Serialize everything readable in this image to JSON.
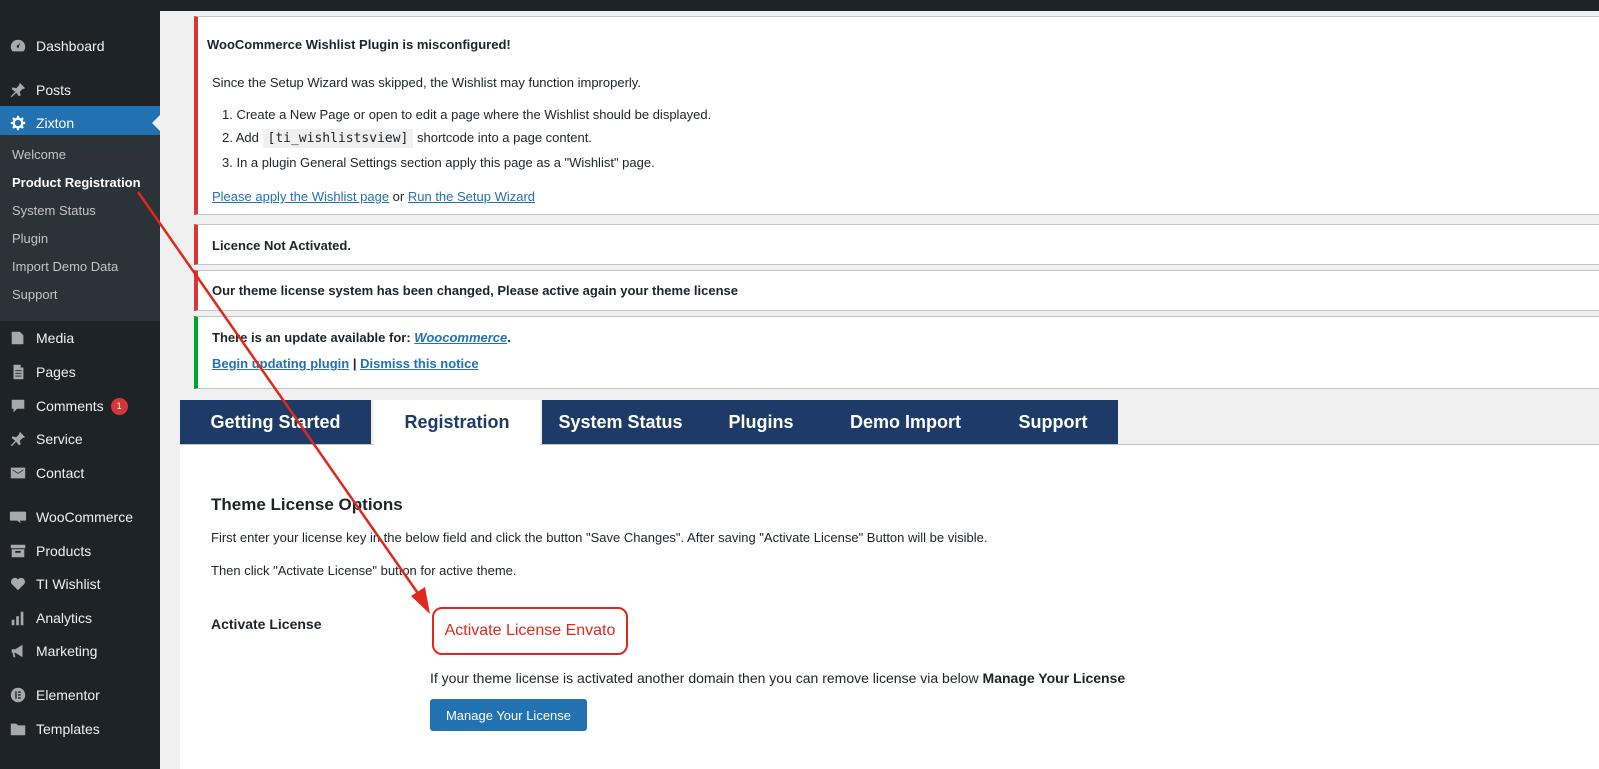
{
  "sidebar": {
    "items": [
      {
        "label": "Dashboard",
        "icon": "dashboard-icon"
      },
      {
        "label": "Posts",
        "icon": "pin-icon"
      },
      {
        "label": "Zixton",
        "icon": "gear-icon"
      },
      {
        "label": "Media",
        "icon": "media-icon"
      },
      {
        "label": "Pages",
        "icon": "pages-icon"
      },
      {
        "label": "Comments",
        "icon": "comment-icon",
        "badge": "1"
      },
      {
        "label": "Service",
        "icon": "pin-icon"
      },
      {
        "label": "Contact",
        "icon": "mail-icon"
      },
      {
        "label": "WooCommerce",
        "icon": "woo-icon"
      },
      {
        "label": "Products",
        "icon": "archive-icon"
      },
      {
        "label": "TI Wishlist",
        "icon": "heart-icon"
      },
      {
        "label": "Analytics",
        "icon": "chart-icon"
      },
      {
        "label": "Marketing",
        "icon": "megaphone-icon"
      },
      {
        "label": "Elementor",
        "icon": "elementor-icon"
      },
      {
        "label": "Templates",
        "icon": "folder-icon"
      }
    ],
    "submenu": [
      "Welcome",
      "Product Registration",
      "System Status",
      "Plugin",
      "Import Demo Data",
      "Support"
    ]
  },
  "notices": {
    "wishlist": {
      "title": "WooCommerce Wishlist Plugin is misconfigured!",
      "intro": "Since the Setup Wizard was skipped, the Wishlist may function improperly.",
      "step1": "1. Create a New Page or open to edit a page where the Wishlist should be displayed.",
      "step2_prefix": "2. Add",
      "step2_code": "[ti_wishlistsview]",
      "step2_suffix": "shortcode into a page content.",
      "step3": "3. In a plugin General Settings section apply this page as a \"Wishlist\" page.",
      "link1": "Please apply the Wishlist page",
      "or": "or",
      "link2": "Run the Setup Wizard"
    },
    "licence": "Licence Not Activated.",
    "theme_license": "Our theme license system has been changed, Please active again your theme license",
    "update": {
      "prefix": "There is an update available for:",
      "plugin": "Woocommerce",
      "link1": "Begin updating plugin",
      "sep": "|",
      "link2": "Dismiss this notice"
    }
  },
  "tabs": [
    "Getting Started",
    "Registration",
    "System Status",
    "Plugins",
    "Demo Import",
    "Support"
  ],
  "panel": {
    "title": "Theme License Options",
    "text1": "First enter your license key in the below field and click the button \"Save Changes\". After saving \"Activate License\" Button will be visible.",
    "text2": "Then click \"Activate License\" button for active theme.",
    "activate_label": "Activate License",
    "activate_button": "Activate License Envato",
    "manage_text": "If your theme license is activated another domain then you can remove license via below",
    "manage_text_bold": "Manage Your License",
    "manage_button": "Manage Your License"
  },
  "colors": {
    "sidebar_bg": "#1d2327",
    "accent": "#2271b1",
    "tab_bg": "#1d3b66",
    "error": "#d63638",
    "success": "#00a32a",
    "annotation": "#e0281b"
  }
}
